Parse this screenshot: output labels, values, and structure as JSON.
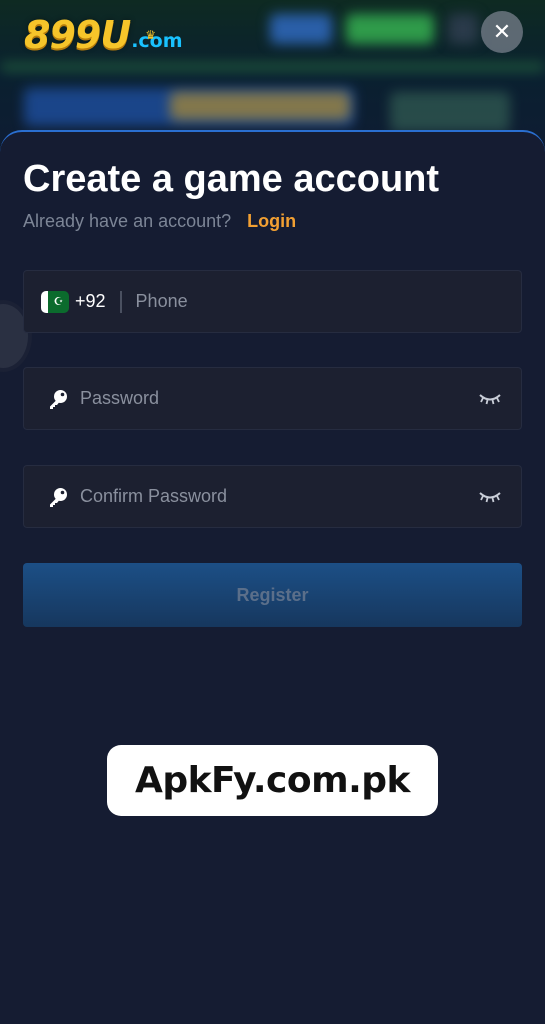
{
  "header": {
    "logo_main": "899U",
    "logo_sub": ".com",
    "close_symbol": "✕",
    "icons": {
      "close": "close-icon",
      "logo_crown": "crown-icon"
    }
  },
  "form": {
    "title": "Create a game account",
    "subtitle": "Already have an account?",
    "login_label": "Login",
    "phone": {
      "country_code": "+92",
      "placeholder": "Phone",
      "flag_icon": "pakistan-flag-icon"
    },
    "password": {
      "placeholder": "Password",
      "icons": {
        "leading": "key-icon",
        "toggle": "eye-closed-icon"
      }
    },
    "confirm_password": {
      "placeholder": "Confirm Password",
      "icons": {
        "leading": "key-icon",
        "toggle": "eye-closed-icon"
      }
    },
    "register_label": "Register"
  },
  "watermark": {
    "text": "ApkFy.com.pk"
  },
  "colors": {
    "sheet_background": "#151c32",
    "field_background": "#1c2030",
    "accent_orange": "#f2a032",
    "register_button": "#1c4f86",
    "logo_gold": "#f6c52a",
    "logo_blue": "#19c2ff"
  }
}
